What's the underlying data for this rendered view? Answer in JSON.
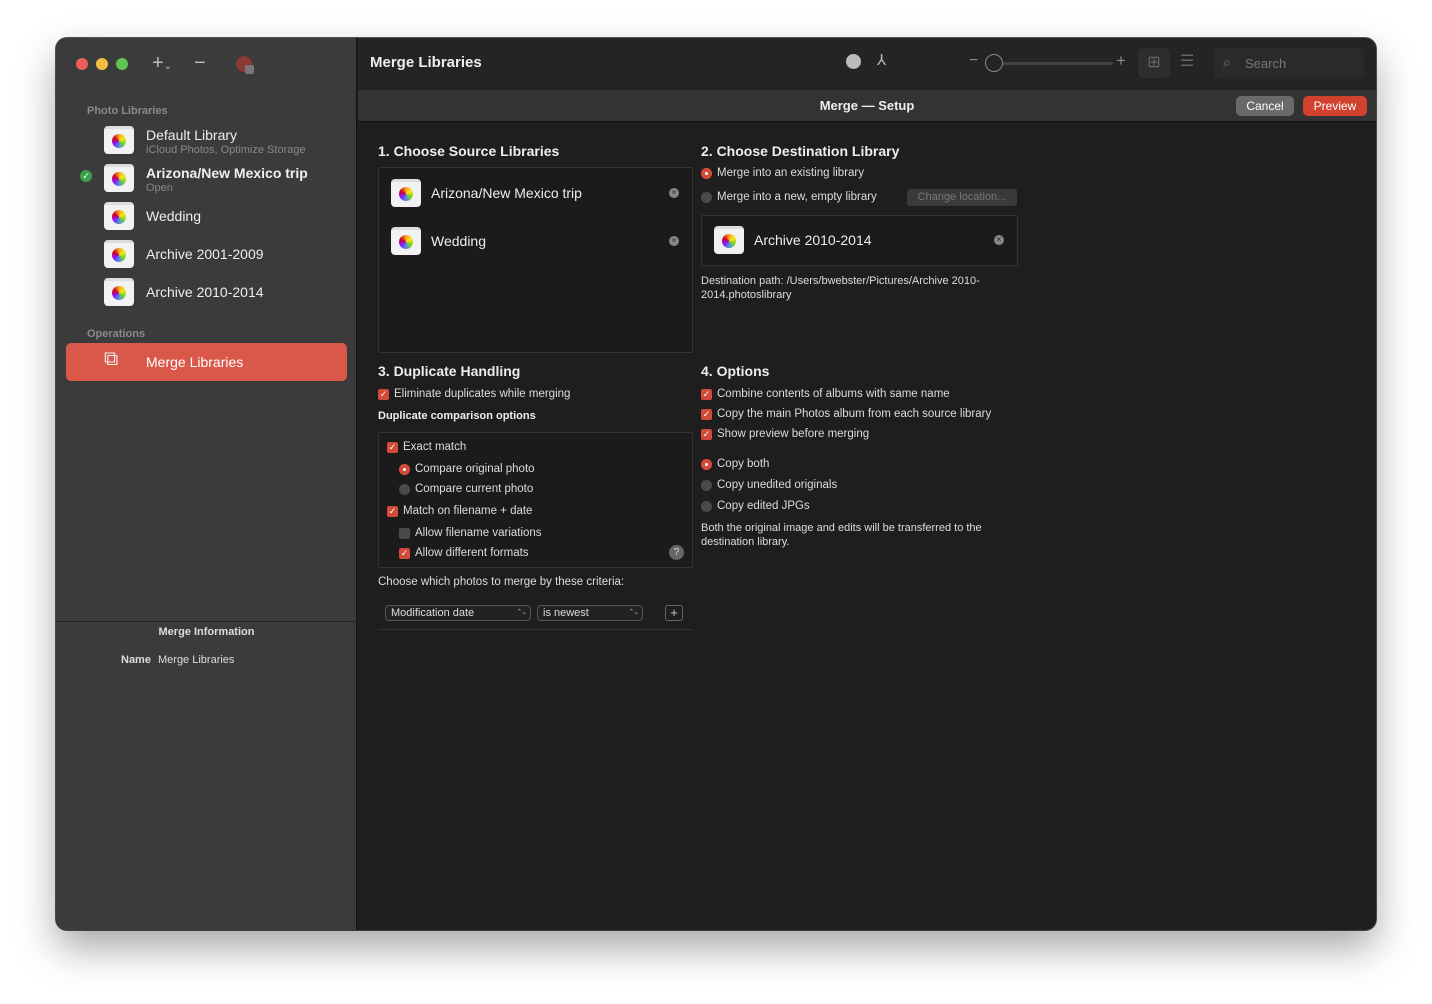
{
  "window": {
    "title": "Merge Libraries",
    "colors": {
      "accent": "#d9584a",
      "sidebar": "#3b3b3b",
      "content": "#1e1e1e"
    }
  },
  "sidebar": {
    "photo_libraries_header": "Photo Libraries",
    "libraries": [
      {
        "name": "Default Library",
        "subtitle": "iCloud Photos, Optimize Storage"
      },
      {
        "name": "Arizona/New Mexico trip",
        "subtitle": "Open",
        "selected_check": true
      },
      {
        "name": "Wedding"
      },
      {
        "name": "Archive 2001-2009"
      },
      {
        "name": "Archive 2010-2014"
      }
    ],
    "operations_header": "Operations",
    "operations": [
      {
        "name": "Merge Libraries",
        "active": true
      }
    ],
    "info": {
      "title": "Merge Information",
      "name_label": "Name",
      "name_value": "Merge Libraries"
    }
  },
  "toolbar": {
    "search_placeholder": "Search"
  },
  "subheader": {
    "title": "Merge — Setup",
    "cancel": "Cancel",
    "preview": "Preview"
  },
  "source": {
    "title": "1. Choose Source Libraries",
    "items": [
      "Arizona/New Mexico trip",
      "Wedding"
    ]
  },
  "destination": {
    "title": "2. Choose Destination Library",
    "opt_existing": "Merge into an existing library",
    "opt_new": "Merge into a new, empty library",
    "change_location": "Change location...",
    "library": "Archive 2010-2014",
    "path": "Destination path: /Users/bwebster/Pictures/Archive 2010-2014.photoslibrary"
  },
  "duplicates": {
    "title": "3. Duplicate Handling",
    "eliminate": "Eliminate duplicates while merging",
    "comparison_header": "Duplicate comparison options",
    "exact": "Exact match",
    "compare_original": "Compare original photo",
    "compare_current": "Compare current photo",
    "filename_date": "Match on filename + date",
    "allow_variations": "Allow filename variations",
    "allow_formats": "Allow different formats",
    "help": "?",
    "criteria_label": "Choose which photos to merge by these criteria:",
    "criteria_field": "Modification date",
    "criteria_op": "is newest",
    "add": "+"
  },
  "options": {
    "title": "4. Options",
    "combine": "Combine contents of albums with same name",
    "copy_main": "Copy the main Photos album from each source library",
    "show_preview": "Show preview before merging",
    "copy_both": "Copy both",
    "copy_unedited": "Copy unedited originals",
    "copy_jpgs": "Copy edited JPGs",
    "description": "Both the original image and edits will be transferred to the destination library."
  }
}
